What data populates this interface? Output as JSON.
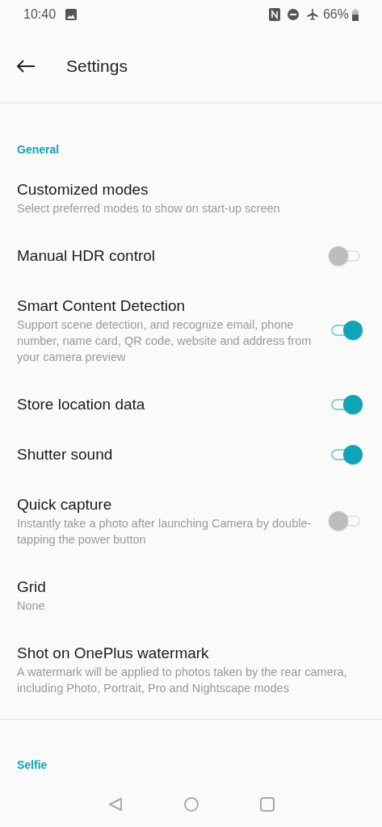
{
  "status_bar": {
    "time": "10:40",
    "battery": "66%"
  },
  "header": {
    "title": "Settings"
  },
  "sections": [
    {
      "title": "General",
      "items": [
        {
          "title": "Customized modes",
          "subtitle": "Select preferred modes to show on start-up screen"
        },
        {
          "title": "Manual HDR control",
          "kind": "switch",
          "on": false
        },
        {
          "title": "Smart Content Detection",
          "subtitle": "Support scene detection, and recognize email, phone number, name card, QR code, website and address from your camera preview",
          "kind": "switch",
          "on": true
        },
        {
          "title": "Store location data",
          "kind": "switch",
          "on": true
        },
        {
          "title": "Shutter sound",
          "kind": "switch",
          "on": true
        },
        {
          "title": "Quick capture",
          "subtitle": "Instantly take a photo after launching Camera by double-tapping the power button",
          "kind": "switch",
          "on": false
        },
        {
          "title": "Grid",
          "subtitle": "None"
        },
        {
          "title": "Shot on OnePlus watermark",
          "subtitle": "A watermark will be applied to photos taken by the rear camera, including Photo, Portrait, Pro and Nightscape modes"
        }
      ]
    },
    {
      "title": "Selfie"
    }
  ]
}
